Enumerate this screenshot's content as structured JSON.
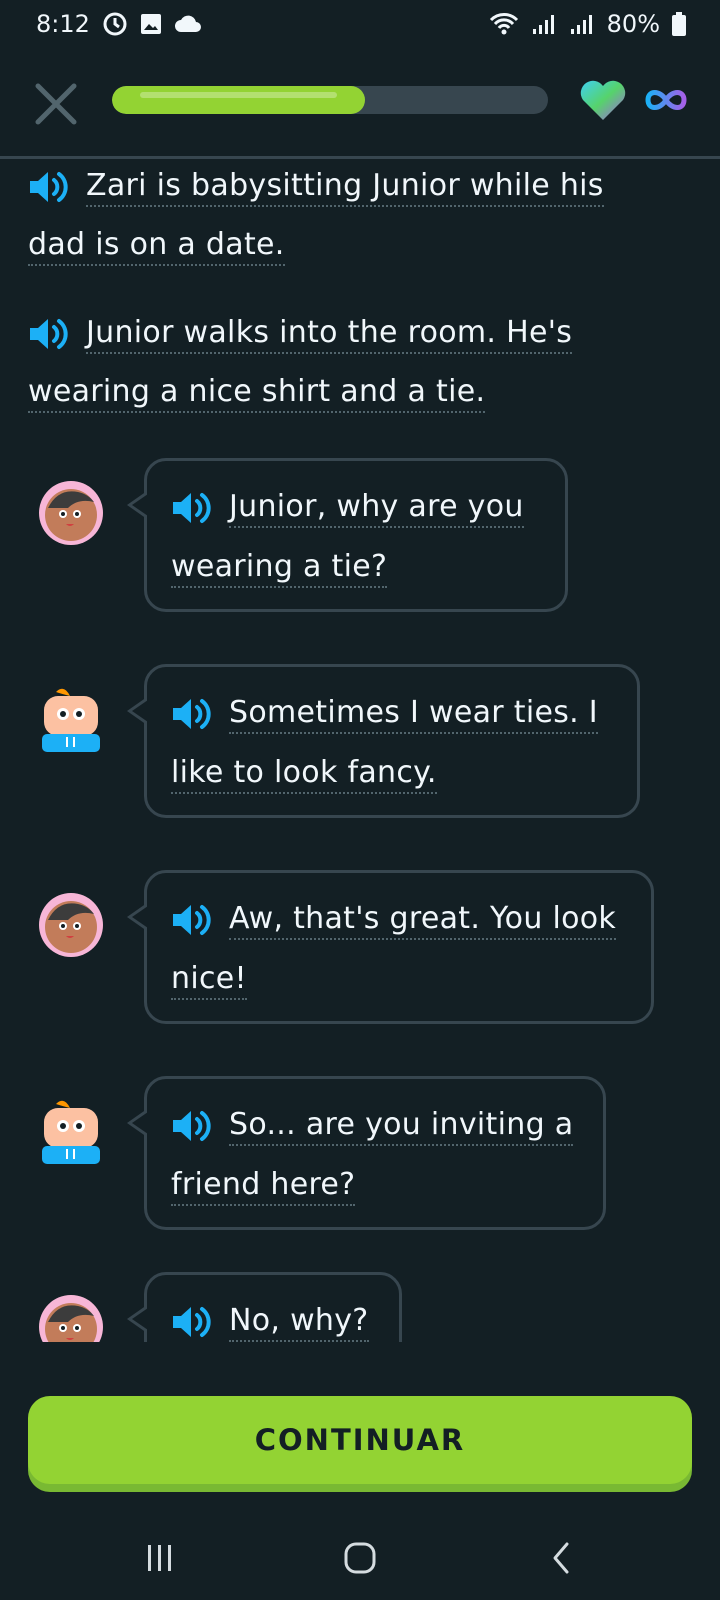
{
  "status_bar": {
    "time": "8:12",
    "battery": "80%",
    "icons": [
      "sync-icon",
      "image-icon",
      "cloud-icon",
      "wifi-icon",
      "signal-icon",
      "signal-icon",
      "battery-icon"
    ]
  },
  "top_bar": {
    "progress_fraction": 0.58,
    "hearts": "infinite"
  },
  "colors": {
    "background": "#131f24",
    "progress": "#93d333",
    "speaker": "#1cb0f6",
    "border": "#37464f",
    "button": "#93d333"
  },
  "narration": [
    {
      "lines": [
        "Zari is babysitting Junior while his",
        "dad is on a date."
      ]
    },
    {
      "lines": [
        "Junior walks into the room. He's",
        "wearing a nice shirt and a tie."
      ]
    }
  ],
  "dialogue": [
    {
      "speaker": "Zari",
      "lines": [
        "Junior, why are you",
        "wearing a tie?"
      ]
    },
    {
      "speaker": "Junior",
      "lines": [
        "Sometimes I wear ties. I",
        "like to look fancy."
      ]
    },
    {
      "speaker": "Zari",
      "lines": [
        "Aw, that's great. You look",
        "nice!"
      ]
    },
    {
      "speaker": "Junior",
      "lines": [
        "So... are you inviting a",
        "friend here?"
      ]
    },
    {
      "speaker": "Zari",
      "lines": [
        "No, why?"
      ]
    }
  ],
  "continue_button": {
    "label": "CONTINUAR"
  },
  "nav_bar": {
    "buttons": [
      "recents-icon",
      "home-icon",
      "back-icon"
    ]
  }
}
